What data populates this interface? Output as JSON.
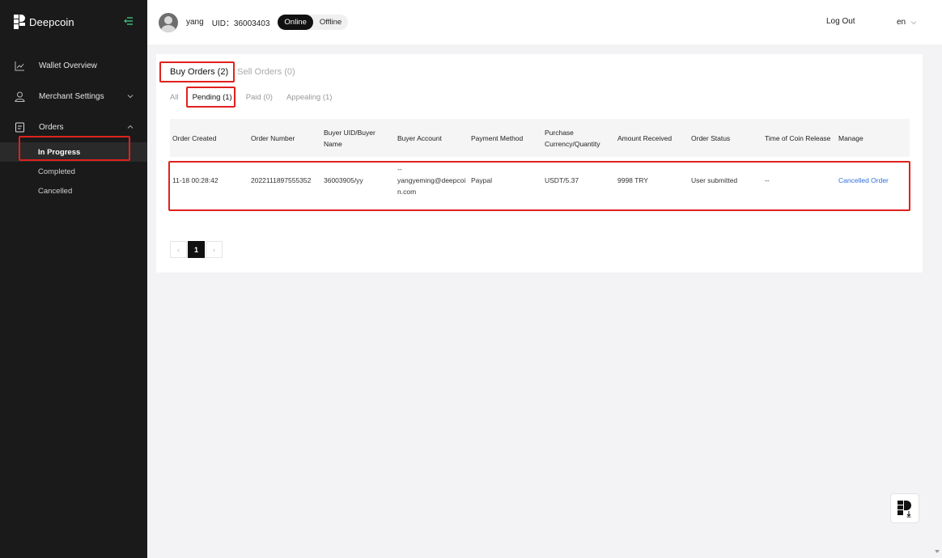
{
  "app": {
    "brand": "Deepcoin"
  },
  "sidebar": {
    "items": [
      {
        "label": "Wallet Overview"
      },
      {
        "label": "Merchant Settings"
      },
      {
        "label": "Orders"
      }
    ],
    "orders_sub": [
      {
        "label": "In Progress"
      },
      {
        "label": "Completed"
      },
      {
        "label": "Cancelled"
      }
    ]
  },
  "header": {
    "username": "yang",
    "uid": "UID：36003403",
    "status_online": "Online",
    "status_offline": "Offline",
    "logout": "Log Out",
    "lang": "en"
  },
  "main": {
    "tabs": [
      {
        "label": "Buy Orders (2)"
      },
      {
        "label": "Sell Orders (0)"
      }
    ],
    "subtabs": [
      {
        "label": "All"
      },
      {
        "label": "Pending (1)"
      },
      {
        "label": "Paid (0)"
      },
      {
        "label": "Appealing (1)"
      }
    ],
    "table": {
      "headers": [
        "Order Created",
        "Order Number",
        "Buyer UID/Buyer Name",
        "Buyer Account",
        "Payment Method",
        "Purchase Currency/Quantity",
        "Amount Received",
        "Order Status",
        "Time of Coin Release",
        "Manage"
      ],
      "rows": [
        [
          "11-18 00:28:42",
          "2022111897555352",
          "36003905/yy",
          "--\nyangyeming@deepcoin.com",
          "Paypal",
          "USDT/5.37",
          "9998 TRY",
          "User submitted",
          "--",
          "Cancelled Order"
        ]
      ]
    },
    "pagination": {
      "current": "1",
      "prev": "‹",
      "next": "›"
    }
  },
  "colors": {
    "accent_red": "#e0211d",
    "link_blue": "#2f6fdc",
    "sidebar_bg": "#1a1a1a",
    "sidebar_accent_green": "#3fbf7f"
  }
}
